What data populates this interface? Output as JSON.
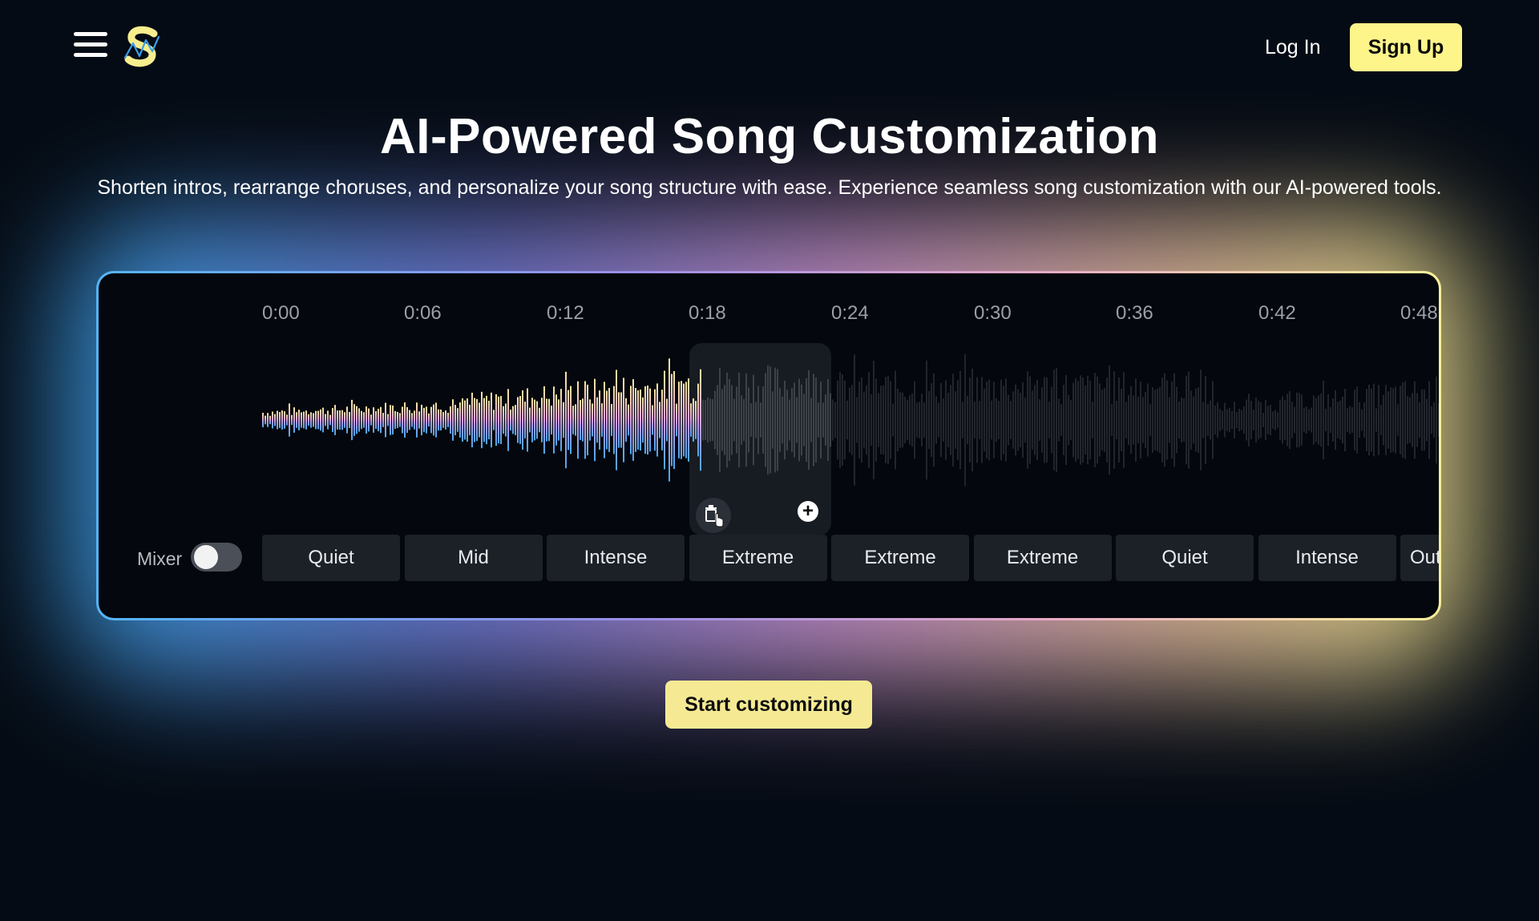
{
  "header": {
    "login_label": "Log In",
    "signup_label": "Sign Up"
  },
  "hero": {
    "title": "AI-Powered Song Customization",
    "subtitle": "Shorten intros, rearrange choruses, and personalize your song structure with ease. Experience seamless song customization with our AI-powered tools."
  },
  "editor": {
    "timeline": [
      "0:00",
      "0:06",
      "0:12",
      "0:18",
      "0:24",
      "0:30",
      "0:36",
      "0:42",
      "0:48"
    ],
    "mixer_label": "Mixer",
    "mixer_on": false,
    "segments": [
      "Quiet",
      "Mid",
      "Intense",
      "Extreme",
      "Extreme",
      "Extreme",
      "Quiet",
      "Intense",
      "Out"
    ],
    "selected_segment_index": 3
  },
  "cta": {
    "label": "Start customizing"
  },
  "colors": {
    "accent": "#fdf58a",
    "background": "#050b14",
    "glow_left": "#3aa8f0",
    "glow_right": "#f5ea8e"
  },
  "icons": {
    "menu": "hamburger-icon",
    "logo": "logo-s-icon",
    "trash": "trash-icon",
    "add": "plus-circle-icon",
    "cursor": "hand-cursor-icon"
  }
}
